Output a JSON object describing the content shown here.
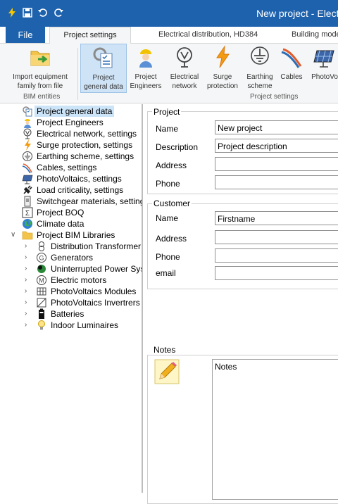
{
  "window": {
    "title": "New project - Electr"
  },
  "quick_access": [
    {
      "icon": "lightning-icon",
      "color": "#f7c600"
    },
    {
      "icon": "save-icon"
    },
    {
      "icon": "undo-icon"
    },
    {
      "icon": "redo-icon"
    }
  ],
  "tabs": {
    "file": "File",
    "items": [
      {
        "label": "Project settings",
        "active": true
      },
      {
        "label": "Electrical distribution, HD384"
      },
      {
        "label": "Building mode"
      }
    ]
  },
  "ribbon": {
    "buttons": [
      {
        "label1": "Import equipment",
        "label2": "family from file",
        "icon": "folder-import-icon"
      },
      {
        "label1": "Project",
        "label2": "general data",
        "icon": "project-data-icon",
        "selected": true
      },
      {
        "label1": "Project",
        "label2": "Engineers",
        "icon": "engineer-icon"
      },
      {
        "label1": "Electrical",
        "label2": "network",
        "icon": "electrical-network-icon"
      },
      {
        "label1": "Surge",
        "label2": "protection",
        "icon": "surge-icon"
      },
      {
        "label1": "Earthing",
        "label2": "scheme",
        "icon": "earthing-icon"
      },
      {
        "label1": "Cables",
        "label2": "",
        "icon": "cables-icon"
      },
      {
        "label1": "PhotoVo",
        "label2": "",
        "icon": "photovoltaic-icon"
      }
    ],
    "groups": {
      "bim": "BIM entities",
      "settings": "Project settings"
    }
  },
  "tree": {
    "items": [
      {
        "label": "Project general data",
        "icon": "project-data-icon",
        "selected": true
      },
      {
        "label": "Project Engineers",
        "icon": "engineer-icon"
      },
      {
        "label": "Electrical network, settings",
        "icon": "electrical-network-icon"
      },
      {
        "label": "Surge protection, settings",
        "icon": "surge-icon"
      },
      {
        "label": "Earthing scheme, settings",
        "icon": "earthing-icon"
      },
      {
        "label": "Cables, settings",
        "icon": "cables-icon"
      },
      {
        "label": "PhotoVoltaics, settings",
        "icon": "photovoltaic-icon"
      },
      {
        "label": "Load criticality, settings",
        "icon": "plug-icon"
      },
      {
        "label": "Switchgear materials, settings",
        "icon": "switchgear-icon"
      },
      {
        "label": "Project BOQ",
        "icon": "boq-icon"
      },
      {
        "label": "Climate data",
        "icon": "globe-icon"
      },
      {
        "label": "Project BIM Libraries",
        "icon": "folder-icon"
      }
    ],
    "children": [
      {
        "label": "Distribution Transformer",
        "icon": "transformer-icon"
      },
      {
        "label": "Generators",
        "icon": "generator-icon"
      },
      {
        "label": "Uninterrupted Power Sys",
        "icon": "ups-icon"
      },
      {
        "label": "Electric motors",
        "icon": "motor-icon"
      },
      {
        "label": "PhotoVoltaics  Modules",
        "icon": "pv-module-icon"
      },
      {
        "label": "PhotoVoltaics Invertrers",
        "icon": "inverter-icon"
      },
      {
        "label": "Batteries",
        "icon": "battery-icon"
      },
      {
        "label": "Indoor Luminaires",
        "icon": "lamp-icon"
      }
    ]
  },
  "project": {
    "title": "Project",
    "name_label": "Name",
    "name_value": "New project",
    "description_label": "Description",
    "description_value": "Project description",
    "address_label": "Address",
    "address_value": "",
    "phone_label": "Phone",
    "phone_value": ""
  },
  "customer": {
    "title": "Customer",
    "name_label": "Name",
    "name_value": "Firstname",
    "address_label": "Address",
    "address_value": "",
    "phone_label": "Phone",
    "phone_value": "",
    "email_label": "email",
    "email_value": ""
  },
  "notes": {
    "title": "Notes",
    "value": "Notes",
    "icon": "pencil-icon"
  },
  "colors": {
    "accent": "#1e62ad",
    "selected": "#cce4f7"
  }
}
